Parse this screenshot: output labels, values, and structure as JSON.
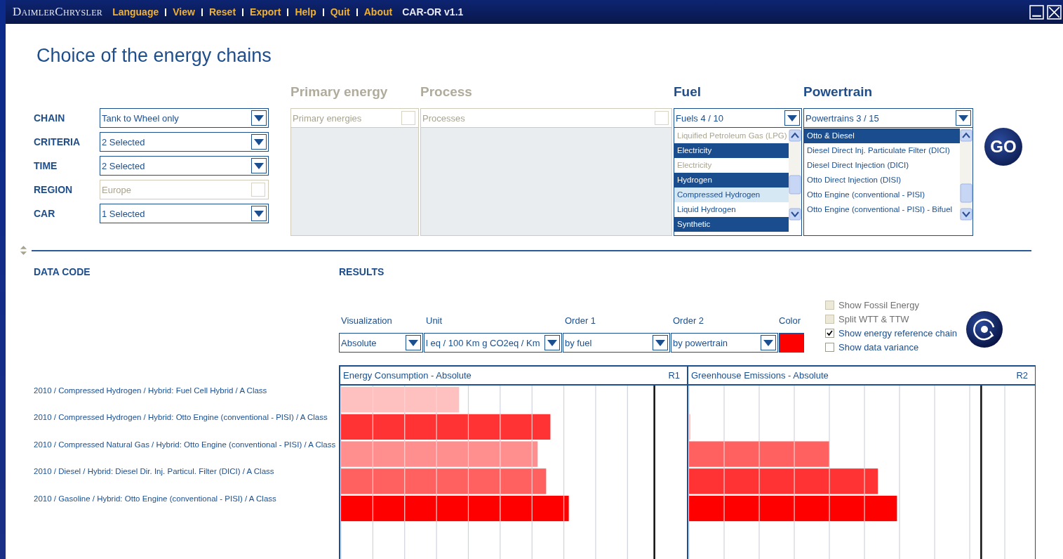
{
  "menu_bar": {
    "brand": "DaimlerChrysler",
    "items": [
      "Language",
      "View",
      "Reset",
      "Export",
      "Help",
      "Quit",
      "About"
    ],
    "version": "CAR-OR v1.1"
  },
  "page_title": "Choice of the energy chains",
  "filters": [
    {
      "label": "CHAIN",
      "value": "Tank to Wheel only",
      "disabled": false
    },
    {
      "label": "CRITERIA",
      "value": "2 Selected",
      "disabled": false
    },
    {
      "label": "TIME",
      "value": "2 Selected",
      "disabled": false
    },
    {
      "label": "REGION",
      "value": "Europe",
      "disabled": true
    },
    {
      "label": "CAR",
      "value": "1 Selected",
      "disabled": false
    }
  ],
  "chain_columns": [
    {
      "heading": "Primary energy",
      "value": "Primary energies",
      "disabled": true
    },
    {
      "heading": "Process",
      "value": "Processes",
      "disabled": true
    },
    {
      "heading": "Fuel",
      "value": "Fuels 4 / 10",
      "disabled": false,
      "items": [
        {
          "label": "Liquified Petroleum Gas (LPG)",
          "selected": false,
          "disabled": true,
          "highlighted": false
        },
        {
          "label": "Electricity",
          "selected": true,
          "disabled": false,
          "highlighted": false
        },
        {
          "label": "Electricity",
          "selected": false,
          "disabled": true,
          "highlighted": false
        },
        {
          "label": "Hydrogen",
          "selected": true,
          "disabled": false,
          "highlighted": false
        },
        {
          "label": "Compressed Hydrogen",
          "selected": false,
          "disabled": false,
          "highlighted": true
        },
        {
          "label": "Liquid Hydrogen",
          "selected": false,
          "disabled": false,
          "highlighted": false
        },
        {
          "label": "Synthetic",
          "selected": true,
          "disabled": false,
          "highlighted": false
        }
      ]
    },
    {
      "heading": "Powertrain",
      "value": "Powertrains 3 / 15",
      "disabled": false,
      "items": [
        {
          "label": "Otto & Diesel",
          "selected": true,
          "disabled": false,
          "highlighted": false
        },
        {
          "label": "Diesel Direct Inj. Particulate Filter (DICI)",
          "selected": false,
          "disabled": false,
          "highlighted": false
        },
        {
          "label": "Diesel Direct Injection (DICI)",
          "selected": false,
          "disabled": false,
          "highlighted": false
        },
        {
          "label": "Otto Direct Injection (DISI)",
          "selected": false,
          "disabled": false,
          "highlighted": false
        },
        {
          "label": "Otto Engine (conventional - PISI)",
          "selected": false,
          "disabled": false,
          "highlighted": false
        },
        {
          "label": "Otto Engine (conventional - PISI) - Bifuel",
          "selected": false,
          "disabled": false,
          "highlighted": false
        }
      ]
    }
  ],
  "go_button": "GO",
  "data_code": {
    "heading": "DATA CODE",
    "rows": [
      "2010 / Compressed Hydrogen / Hybrid: Fuel Cell Hybrid / A Class",
      "2010 / Compressed Hydrogen / Hybrid: Otto Engine (conventional - PISI)  / A Class",
      "2010 / Compressed Natural Gas / Hybrid: Otto Engine (conventional - PISI)  / A Class",
      "2010 / Diesel / Hybrid: Diesel Dir. Inj. Particul. Filter (DICI) / A Class",
      "2010 / Gasoline / Hybrid: Otto Engine (conventional - PISI)  / A Class"
    ]
  },
  "results": {
    "heading": "RESULTS",
    "controls": [
      {
        "label": "Visualization",
        "value": "Absolute"
      },
      {
        "label": "Unit",
        "value": "l eq / 100 Km g CO2eq / Km"
      },
      {
        "label": "Order 1",
        "value": "by fuel"
      },
      {
        "label": "Order 2",
        "value": "by powertrain"
      }
    ],
    "color_label": "Color",
    "color": "#ff0000",
    "options": [
      {
        "label": "Show Fossil Energy",
        "checked": false,
        "disabled": true
      },
      {
        "label": "Split WTT & TTW",
        "checked": false,
        "disabled": true
      },
      {
        "label": "Show energy reference chain",
        "checked": true,
        "disabled": false
      },
      {
        "label": "Show data variance",
        "checked": false,
        "disabled": false
      }
    ],
    "charts": [
      {
        "title": "Energy Consumption - Absolute",
        "tag": "R1"
      },
      {
        "title": "Greenhouse Emissions - Absolute",
        "tag": "R2"
      }
    ]
  }
}
